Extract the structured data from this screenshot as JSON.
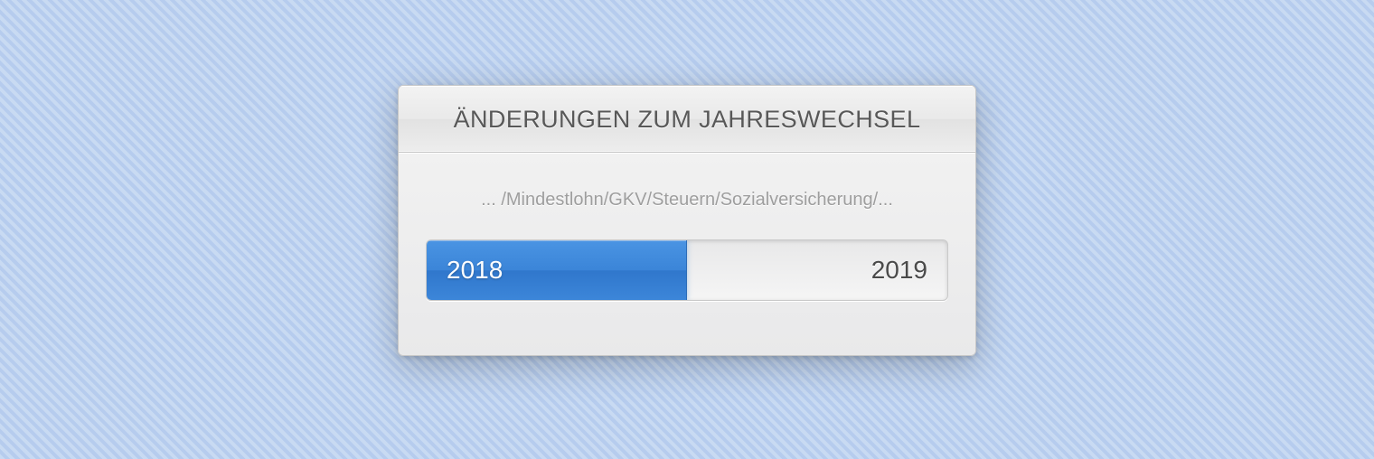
{
  "window": {
    "title": "ÄNDERUNGEN ZUM JAHRESWECHSEL",
    "subtitle": "... /Mindestlohn/GKV/Steuern/Sozialversicherung/..."
  },
  "progress": {
    "start_label": "2018",
    "end_label": "2019",
    "percent": 50
  }
}
